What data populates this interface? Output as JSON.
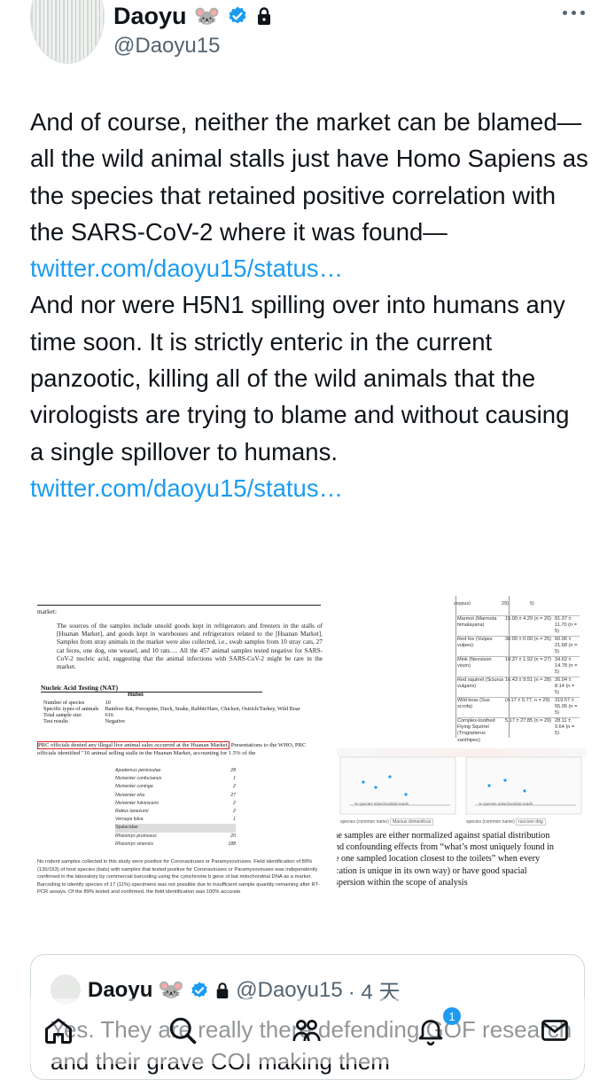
{
  "author": {
    "name": "Daoyu",
    "emoji": "🐭",
    "handle": "@Daoyu15"
  },
  "tweet": {
    "paragraph1": "And of course, neither the market can be blamed—all the wild animal stalls just have Homo Sapiens as the species that retained positive correlation with the SARS-CoV-2 where it was found—",
    "link1": "twitter.com/daoyu15/status…",
    "paragraph2": "And nor were H5N1 spilling over into humans any time soon. It is strictly enteric in the current panzootic, killing all of the wild animals that the virologists are trying to blame and without causing a single spillover to humans.",
    "link2": "twitter.com/daoyu15/status…"
  },
  "media": {
    "left_doc": {
      "top_line": "market:",
      "body": "The sources of the samples include unsold goods kept in refrigerators and freezers in the stalls of [Huanan Market], and goods kept in warehouses and refrigerators related to the [Huanan Market]. Samples from stray animals in the market were also collected, i.e., swab samples from 10 stray cats, 27 cat feces, one dog, one weasel, and 10 rats…. All the 457 animal samples tested negative for SARS-CoV-2 nucleic acid, suggesting that the animal infections with SARS-CoV-2 might be rare in the market.",
      "table_title": "Nucleic Acid Testing (NAT)",
      "table_col": "Hubei",
      "table_rows": [
        [
          "Number of species",
          "10"
        ],
        [
          "Specific types of animals",
          "Bamboo Rat, Porcupine, Duck, Snake, Rabbit/Hare, Chicken, Ostrich/Turkey, Wild Boar"
        ],
        [
          "Total sample size",
          "616"
        ],
        [
          "Test results",
          "Negative"
        ]
      ],
      "red_line": "PRC officials denied any illegal live animal sales occurred at the Huanan Market.",
      "red_line_cont": "Presentations to the WHO, PRC officials identified \"10 animal selling stalls in the Huanan Market, accounting for 1.5% of the",
      "species": [
        [
          "Apodemus peninsulae",
          "28"
        ],
        [
          "Niviventer confucianus",
          "1"
        ],
        [
          "Niviventer coninga",
          "2"
        ],
        [
          "Niviventer eha",
          "27"
        ],
        [
          "Niviventer fulvescens",
          "2"
        ],
        [
          "Rattus tanezumi",
          "2"
        ],
        [
          "Vernaya fulva",
          "1"
        ],
        [
          "Spalacidae",
          ""
        ],
        [
          "Rhizomys pruinosus",
          "20"
        ],
        [
          "Rhizomys sinensis",
          "188"
        ]
      ],
      "bottom": "No rodent samples collected in this study were positive for Coronaviruses or Paramyxoviruses. Field identification of 89% (136/153) of host species (bats) with samples that tested positive for Coronaviruses or Paramyxoviruses was independently confirmed in the laboratory by commercial barcoding using the cytochrome b gene of bat mitochondrial DNA as a marker. Barcoding to identify species of 17 (11%) specimens was not possible due to insufficient sample quantity remaining after RT-PCR assays. Of the 89% tested and confirmed, the field identification was 100% accurate"
    },
    "right_top": {
      "rows": [
        [
          "coypus)",
          "29)",
          "5)"
        ],
        [
          "Marmot (Marmota himalayana)",
          "15.00 ± 4.29 (n = 20)",
          "81.37 ± 11.70 (n = 5)"
        ],
        [
          "Red fox (Vulpes vulpes)",
          "30.00 ± 0.00 (n = 25)",
          "60.96 ± 21.68 (n = 5)"
        ],
        [
          "Mink (Neovison vison)",
          "10.37 ± 1.92 (n = 27)",
          "34.62 ± 14.78 (n = 5)"
        ],
        [
          "Red squirrel (Sciurus vulgaris)",
          "16.43 ± 9.51 (n = 28)",
          "26.04 ± 8.14 (n = 5)"
        ],
        [
          "Wild boar (Sus scrofa)",
          "(4.17 ± 5.77, n = 29)",
          "319.57 ± 55.95 (n = 5)"
        ],
        [
          "Complex-toothed Flying Squirrel (Trogopterus xanthipes)",
          "5.17 ± 27.85 (n = 29)",
          "28.11 ± 9.64 (n = 5)"
        ]
      ]
    },
    "right_bot": {
      "caption": "The samples are either normalized against spatial distribution (and confounding effects from “what’s most uniquely found in the one sampled location closest to the toilets” when every location is unique in its own way) or have good spacial dispersion within the scope of analysis",
      "chart_axis_left": "% species mitochondrial reads",
      "chart_axis_right": "% species mitochondrial reads",
      "select_label_left": "species (common name)",
      "select_value_left": "Marsus domesticus",
      "select_label_right": "species (common name)",
      "select_value_right": "raccoon dog"
    }
  },
  "quote": {
    "name": "Daoyu",
    "emoji": "🐭",
    "handle": "@Daoyu15",
    "time": "· 4 天",
    "text": "Yes. They are really there defending GOF research and their grave COI making them"
  },
  "tabbar": {
    "notifications_badge": "1"
  }
}
